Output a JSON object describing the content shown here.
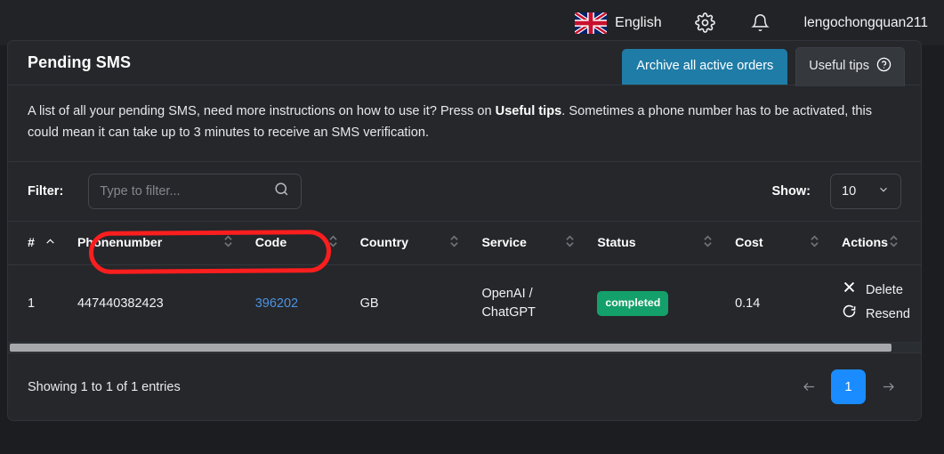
{
  "topbar": {
    "flag_icon": "uk-flag-icon",
    "language": "English",
    "settings_icon": "gear-icon",
    "notifications_icon": "bell-icon",
    "username": "lengochongquan211"
  },
  "card": {
    "title": "Pending SMS",
    "archive_button": "Archive all active orders",
    "tips_button": "Useful tips",
    "tips_icon": "question-circle-icon",
    "description_part1": "A list of all your pending SMS, need more instructions on how to use it? Press on ",
    "description_bold": "Useful tips",
    "description_part2": ". Sometimes a phone number has to be activated, this could mean it can take up to 3 minutes to receive an SMS verification."
  },
  "controls": {
    "filter_label": "Filter:",
    "filter_value": "",
    "filter_placeholder": "Type to filter...",
    "search_icon": "search-icon",
    "show_label": "Show:",
    "show_value": "10",
    "show_chevron_icon": "chevron-down-icon"
  },
  "table": {
    "columns": [
      {
        "label": "#",
        "sort_icon": "chevron-up-icon"
      },
      {
        "label": "Phonenumber",
        "sort_icon": "sort-updown-icon"
      },
      {
        "label": "Code",
        "sort_icon": "sort-updown-icon"
      },
      {
        "label": "Country",
        "sort_icon": "sort-updown-icon"
      },
      {
        "label": "Service",
        "sort_icon": "sort-updown-icon"
      },
      {
        "label": "Status",
        "sort_icon": "sort-updown-icon"
      },
      {
        "label": "Cost",
        "sort_icon": "sort-updown-icon"
      },
      {
        "label": "Actions",
        "sort_icon": "sort-updown-icon"
      }
    ],
    "rows": [
      {
        "index": "1",
        "phonenumber": "447440382423",
        "code": "396202",
        "country": "GB",
        "service_line1": "OpenAI /",
        "service_line2": "ChatGPT",
        "status": "completed",
        "cost": "0.14",
        "delete_label": "Delete",
        "delete_icon": "close-x-icon",
        "resend_label": "Resend",
        "resend_icon": "refresh-icon"
      }
    ]
  },
  "footer": {
    "showing_text": "Showing 1 to 1 of 1 entries",
    "prev_icon": "arrow-left-icon",
    "page_current": "1",
    "next_icon": "arrow-right-icon"
  },
  "colors": {
    "page_background": "#1b1d21",
    "card_background": "#25272b",
    "archive_button": "#1f7ca6",
    "status_completed": "#14a06a",
    "code_link": "#4d93e0",
    "pagination_active": "#1a8cff",
    "annotation_red": "#fa1e1e"
  }
}
